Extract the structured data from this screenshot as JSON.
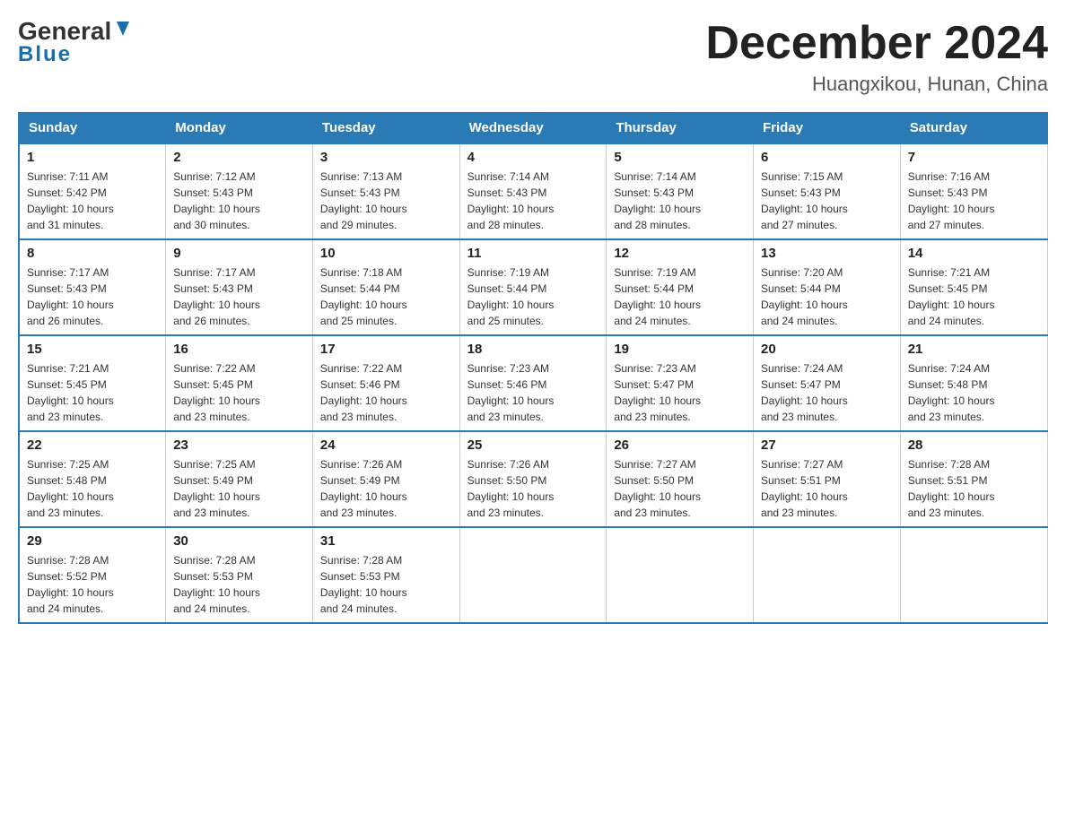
{
  "header": {
    "logo_main": "General",
    "logo_sub": "Blue",
    "month_title": "December 2024",
    "location": "Huangxikou, Hunan, China"
  },
  "days_of_week": [
    "Sunday",
    "Monday",
    "Tuesday",
    "Wednesday",
    "Thursday",
    "Friday",
    "Saturday"
  ],
  "weeks": [
    [
      {
        "day": "1",
        "sunrise": "7:11 AM",
        "sunset": "5:42 PM",
        "daylight": "10 hours and 31 minutes."
      },
      {
        "day": "2",
        "sunrise": "7:12 AM",
        "sunset": "5:43 PM",
        "daylight": "10 hours and 30 minutes."
      },
      {
        "day": "3",
        "sunrise": "7:13 AM",
        "sunset": "5:43 PM",
        "daylight": "10 hours and 29 minutes."
      },
      {
        "day": "4",
        "sunrise": "7:14 AM",
        "sunset": "5:43 PM",
        "daylight": "10 hours and 28 minutes."
      },
      {
        "day": "5",
        "sunrise": "7:14 AM",
        "sunset": "5:43 PM",
        "daylight": "10 hours and 28 minutes."
      },
      {
        "day": "6",
        "sunrise": "7:15 AM",
        "sunset": "5:43 PM",
        "daylight": "10 hours and 27 minutes."
      },
      {
        "day": "7",
        "sunrise": "7:16 AM",
        "sunset": "5:43 PM",
        "daylight": "10 hours and 27 minutes."
      }
    ],
    [
      {
        "day": "8",
        "sunrise": "7:17 AM",
        "sunset": "5:43 PM",
        "daylight": "10 hours and 26 minutes."
      },
      {
        "day": "9",
        "sunrise": "7:17 AM",
        "sunset": "5:43 PM",
        "daylight": "10 hours and 26 minutes."
      },
      {
        "day": "10",
        "sunrise": "7:18 AM",
        "sunset": "5:44 PM",
        "daylight": "10 hours and 25 minutes."
      },
      {
        "day": "11",
        "sunrise": "7:19 AM",
        "sunset": "5:44 PM",
        "daylight": "10 hours and 25 minutes."
      },
      {
        "day": "12",
        "sunrise": "7:19 AM",
        "sunset": "5:44 PM",
        "daylight": "10 hours and 24 minutes."
      },
      {
        "day": "13",
        "sunrise": "7:20 AM",
        "sunset": "5:44 PM",
        "daylight": "10 hours and 24 minutes."
      },
      {
        "day": "14",
        "sunrise": "7:21 AM",
        "sunset": "5:45 PM",
        "daylight": "10 hours and 24 minutes."
      }
    ],
    [
      {
        "day": "15",
        "sunrise": "7:21 AM",
        "sunset": "5:45 PM",
        "daylight": "10 hours and 23 minutes."
      },
      {
        "day": "16",
        "sunrise": "7:22 AM",
        "sunset": "5:45 PM",
        "daylight": "10 hours and 23 minutes."
      },
      {
        "day": "17",
        "sunrise": "7:22 AM",
        "sunset": "5:46 PM",
        "daylight": "10 hours and 23 minutes."
      },
      {
        "day": "18",
        "sunrise": "7:23 AM",
        "sunset": "5:46 PM",
        "daylight": "10 hours and 23 minutes."
      },
      {
        "day": "19",
        "sunrise": "7:23 AM",
        "sunset": "5:47 PM",
        "daylight": "10 hours and 23 minutes."
      },
      {
        "day": "20",
        "sunrise": "7:24 AM",
        "sunset": "5:47 PM",
        "daylight": "10 hours and 23 minutes."
      },
      {
        "day": "21",
        "sunrise": "7:24 AM",
        "sunset": "5:48 PM",
        "daylight": "10 hours and 23 minutes."
      }
    ],
    [
      {
        "day": "22",
        "sunrise": "7:25 AM",
        "sunset": "5:48 PM",
        "daylight": "10 hours and 23 minutes."
      },
      {
        "day": "23",
        "sunrise": "7:25 AM",
        "sunset": "5:49 PM",
        "daylight": "10 hours and 23 minutes."
      },
      {
        "day": "24",
        "sunrise": "7:26 AM",
        "sunset": "5:49 PM",
        "daylight": "10 hours and 23 minutes."
      },
      {
        "day": "25",
        "sunrise": "7:26 AM",
        "sunset": "5:50 PM",
        "daylight": "10 hours and 23 minutes."
      },
      {
        "day": "26",
        "sunrise": "7:27 AM",
        "sunset": "5:50 PM",
        "daylight": "10 hours and 23 minutes."
      },
      {
        "day": "27",
        "sunrise": "7:27 AM",
        "sunset": "5:51 PM",
        "daylight": "10 hours and 23 minutes."
      },
      {
        "day": "28",
        "sunrise": "7:28 AM",
        "sunset": "5:51 PM",
        "daylight": "10 hours and 23 minutes."
      }
    ],
    [
      {
        "day": "29",
        "sunrise": "7:28 AM",
        "sunset": "5:52 PM",
        "daylight": "10 hours and 24 minutes."
      },
      {
        "day": "30",
        "sunrise": "7:28 AM",
        "sunset": "5:53 PM",
        "daylight": "10 hours and 24 minutes."
      },
      {
        "day": "31",
        "sunrise": "7:28 AM",
        "sunset": "5:53 PM",
        "daylight": "10 hours and 24 minutes."
      },
      null,
      null,
      null,
      null
    ]
  ],
  "labels": {
    "sunrise": "Sunrise:",
    "sunset": "Sunset:",
    "daylight": "Daylight:"
  }
}
